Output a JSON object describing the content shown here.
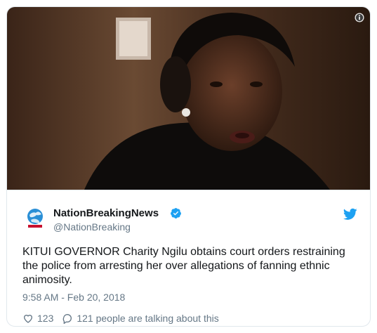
{
  "tweet": {
    "author_name": "NationBreakingNews",
    "author_handle": "@NationBreaking",
    "text": "KITUI GOVERNOR Charity Ngilu obtains court orders restraining the police from arresting her over allegations of fanning ethnic animosity.",
    "timestamp": "9:58 AM - Feb 20, 2018",
    "likes": "123",
    "talking": "121 people are talking about this"
  },
  "icons": {
    "info": "info-icon",
    "verified": "verified-badge-icon",
    "brand": "twitter-bird-icon",
    "like": "heart-icon",
    "reply": "speech-bubble-icon",
    "avatar": "nation-globe-logo"
  },
  "colors": {
    "twitter_blue": "#1da1f2",
    "text": "#14171a",
    "secondary": "#657786",
    "border": "#e1e8ed"
  }
}
